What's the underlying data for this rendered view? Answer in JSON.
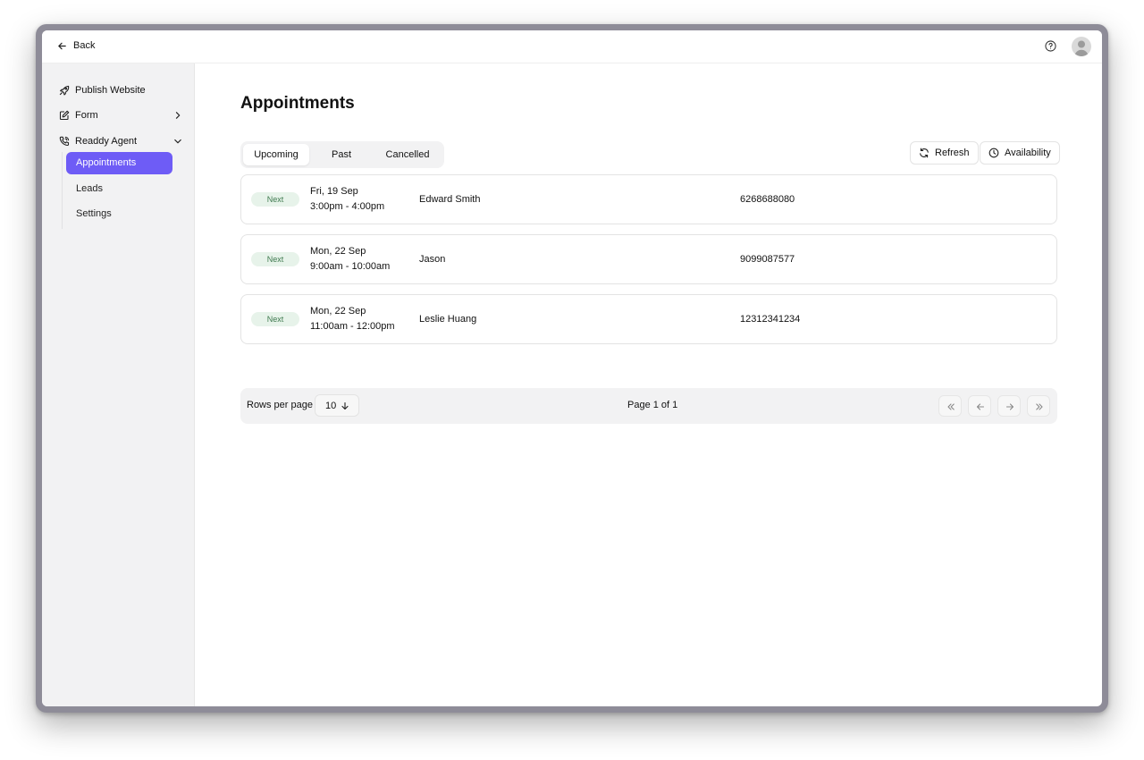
{
  "topbar": {
    "back_label": "Back"
  },
  "sidebar": {
    "items": [
      {
        "label": "Publish Website",
        "icon": "rocket-icon"
      },
      {
        "label": "Form",
        "icon": "edit-form-icon"
      },
      {
        "label": "Readdy Agent",
        "icon": "phone-agent-icon"
      }
    ],
    "subitems": [
      {
        "label": "Appointments",
        "active": true
      },
      {
        "label": "Leads",
        "active": false
      },
      {
        "label": "Settings",
        "active": false
      }
    ]
  },
  "main": {
    "title": "Appointments",
    "tabs": [
      {
        "label": "Upcoming",
        "active": true
      },
      {
        "label": "Past",
        "active": false
      },
      {
        "label": "Cancelled",
        "active": false
      }
    ],
    "refresh_label": "Refresh",
    "availability_label": "Availability",
    "appointments": [
      {
        "badge": "Next",
        "date": "Fri, 19 Sep",
        "time": "3:00pm - 4:00pm",
        "name": "Edward Smith",
        "phone": "6268688080"
      },
      {
        "badge": "Next",
        "date": "Mon, 22 Sep",
        "time": "9:00am - 10:00am",
        "name": "Jason",
        "phone": "9099087577"
      },
      {
        "badge": "Next",
        "date": "Mon, 22 Sep",
        "time": "11:00am - 12:00pm",
        "name": "Leslie Huang",
        "phone": "12312341234"
      }
    ],
    "pagination": {
      "rows_per_page_label": "Rows per page",
      "rows_per_page_value": "10",
      "page_info": "Page 1 of 1"
    }
  },
  "colors": {
    "accent": "#6e5cf6",
    "badge_bg": "#e7f3ea",
    "badge_text": "#3f7a4f",
    "sidebar_bg": "#f2f2f3",
    "frame": "#8e8c98"
  }
}
